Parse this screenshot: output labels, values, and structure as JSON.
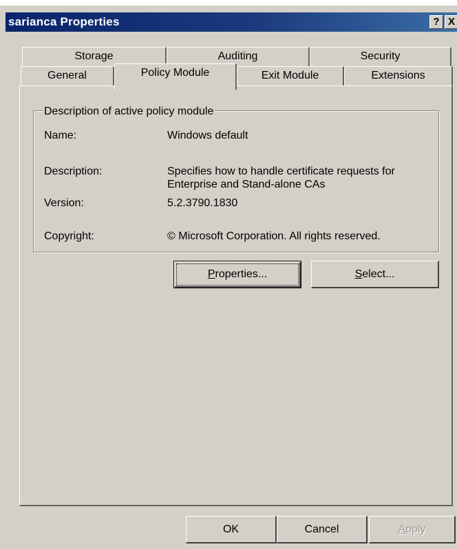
{
  "window": {
    "title": "sarianca Properties",
    "help_glyph": "?",
    "close_glyph": "X"
  },
  "tabs": {
    "row1": [
      "Storage",
      "Auditing",
      "Security"
    ],
    "row2": [
      "General",
      "Policy Module",
      "Exit Module",
      "Extensions"
    ],
    "active": "Policy Module"
  },
  "group": {
    "legend": "Description of active policy module",
    "fields": [
      {
        "label": "Name:",
        "value": "Windows default"
      },
      {
        "label": "Description:",
        "value_line1": "Specifies how to handle certificate requests for",
        "value_line2": "Enterprise and Stand-alone CAs"
      },
      {
        "label": "Version:",
        "value": "5.2.3790.1830"
      },
      {
        "label": "Copyright:",
        "value": "© Microsoft Corporation. All rights reserved."
      }
    ]
  },
  "buttons": {
    "properties_first": "P",
    "properties_rest": "roperties...",
    "select_first": "S",
    "select_rest": "elect...",
    "ok": "OK",
    "cancel": "Cancel",
    "apply_first": "A",
    "apply_rest": "pply"
  }
}
